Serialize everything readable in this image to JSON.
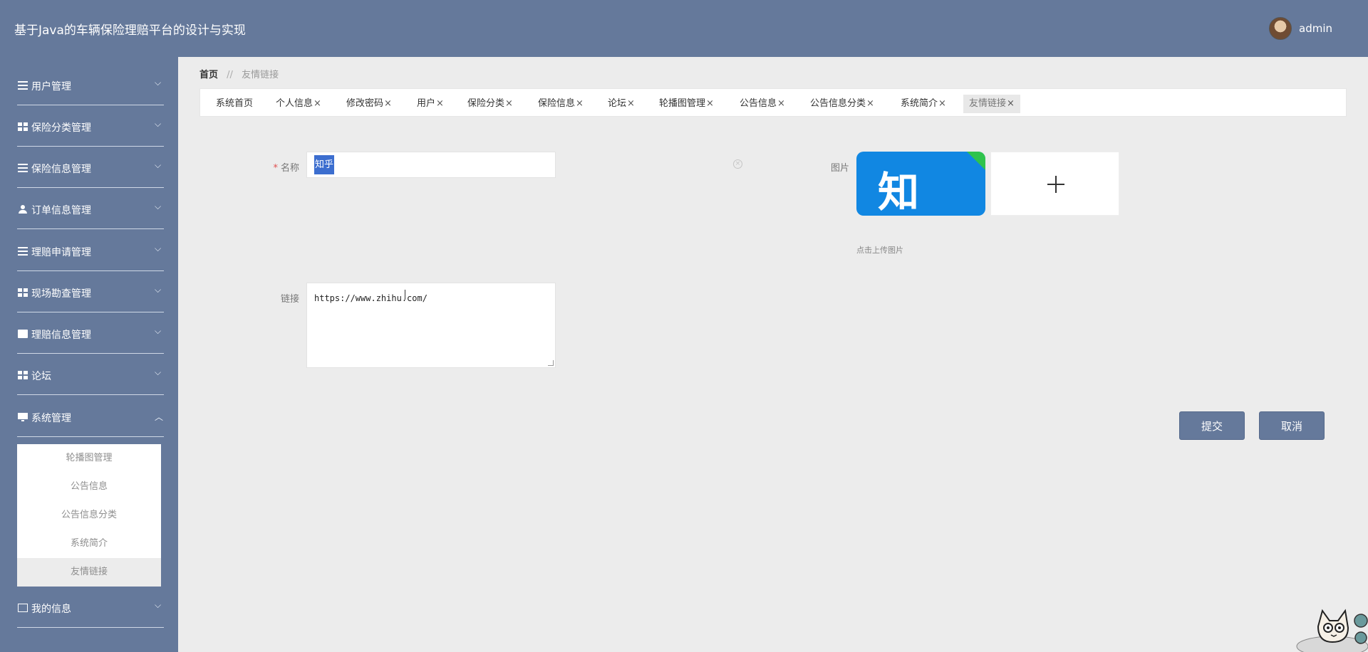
{
  "app": {
    "title": "基于Java的车辆保险理赔平台的设计与实现"
  },
  "user": {
    "name": "admin"
  },
  "sidebar": {
    "items": [
      {
        "label": "用户管理",
        "icon": "list-icon",
        "expanded": false
      },
      {
        "label": "保险分类管理",
        "icon": "grid-icon",
        "expanded": false
      },
      {
        "label": "保险信息管理",
        "icon": "sliders-icon",
        "expanded": false
      },
      {
        "label": "订单信息管理",
        "icon": "person-icon",
        "expanded": false
      },
      {
        "label": "理赔申请管理",
        "icon": "list-icon",
        "expanded": false
      },
      {
        "label": "现场勘查管理",
        "icon": "grid-icon",
        "expanded": false
      },
      {
        "label": "理赔信息管理",
        "icon": "clipboard-icon",
        "expanded": false
      },
      {
        "label": "论坛",
        "icon": "grid-icon",
        "expanded": false
      },
      {
        "label": "系统管理",
        "icon": "monitor-icon",
        "expanded": true
      },
      {
        "label": "我的信息",
        "icon": "card-icon",
        "expanded": false
      }
    ],
    "submenu": [
      "轮播图管理",
      "公告信息",
      "公告信息分类",
      "系统简介",
      "友情链接"
    ],
    "active_sub": "友情链接"
  },
  "breadcrumb": {
    "home": "首页",
    "separator": "//",
    "current": "友情链接"
  },
  "tabs": [
    {
      "label": "系统首页",
      "closable": false
    },
    {
      "label": "个人信息",
      "closable": true
    },
    {
      "label": "修改密码",
      "closable": true
    },
    {
      "label": "用户",
      "closable": true
    },
    {
      "label": "保险分类",
      "closable": true
    },
    {
      "label": "保险信息",
      "closable": true
    },
    {
      "label": "论坛",
      "closable": true
    },
    {
      "label": "轮播图管理",
      "closable": true
    },
    {
      "label": "公告信息",
      "closable": true
    },
    {
      "label": "公告信息分类",
      "closable": true
    },
    {
      "label": "系统简介",
      "closable": true
    },
    {
      "label": "友情链接",
      "closable": true,
      "active": true
    }
  ],
  "tab_close_glyph": "×",
  "form": {
    "name_label": "名称",
    "required_mark": "*",
    "name_value": "知乎",
    "image_label": "图片",
    "image_logo_text": "知",
    "upload_hint": "点击上传图片",
    "link_label": "链接",
    "link_value": "https://www.zhihu.com/",
    "submit_label": "提交",
    "cancel_label": "取消"
  },
  "colors": {
    "primary": "#65799b",
    "background": "#ececec",
    "selection": "#3c6ecf",
    "logo_blue": "#1187e2",
    "logo_corner": "#2fc34c",
    "required": "#e05050"
  }
}
